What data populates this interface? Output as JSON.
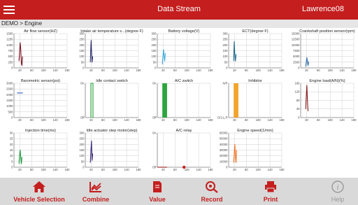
{
  "header": {
    "title": "Data Stream",
    "user": "Lawrence08"
  },
  "breadcrumb": "DEMO > Engine",
  "colors": {
    "accent": "#c41e1e",
    "series": [
      "#7a1020",
      "#2a2a6a",
      "#3aa8d8",
      "#1a6a8a",
      "#2e6aa8",
      "#2a5abf",
      "#22a035",
      "#22a035",
      "#f0a020",
      "#8a1a1a",
      "#1d9a3c",
      "#3a2a7a",
      "#a01818",
      "#f07020"
    ]
  },
  "nav": [
    {
      "label": "Vehicle Selection",
      "icon": "home-icon"
    },
    {
      "label": "Combine",
      "icon": "combine-chart-icon"
    },
    {
      "label": "Value",
      "icon": "document-value-icon"
    },
    {
      "label": "Record",
      "icon": "record-search-icon"
    },
    {
      "label": "Print",
      "icon": "printer-icon"
    },
    {
      "label": "Help",
      "icon": "info-help-icon"
    }
  ],
  "chart_data": [
    {
      "type": "line",
      "title": "Air flow sensor(HZ)",
      "xlim": [
        0,
        180
      ],
      "xticks": [
        "20",
        "60",
        "100",
        "140",
        "180"
      ],
      "ylim": [
        0,
        1500
      ],
      "yticks": [
        "0",
        "250",
        "500",
        "750",
        "1000",
        "1250",
        "1500"
      ],
      "series": [
        {
          "x": [
            17,
            19,
            21,
            23,
            25,
            27,
            29
          ],
          "y": [
            300,
            700,
            1100,
            800,
            200,
            100,
            500
          ]
        }
      ]
    },
    {
      "type": "line",
      "title": "Intake air temperature s...(degree F)",
      "xlim": [
        0,
        180
      ],
      "xticks": [
        "20",
        "60",
        "100",
        "140",
        "180"
      ],
      "ylim": [
        0,
        300
      ],
      "yticks": [
        "0",
        "50",
        "100",
        "150",
        "200",
        "250",
        "300"
      ],
      "series": [
        {
          "x": [
            17,
            19,
            20,
            21,
            23,
            25
          ],
          "y": [
            50,
            200,
            240,
            150,
            50,
            100
          ]
        }
      ]
    },
    {
      "type": "line",
      "title": "Battery voltage(V)",
      "xlim": [
        0,
        180
      ],
      "xticks": [
        "20",
        "60",
        "100",
        "140",
        "180"
      ],
      "ylim": [
        0,
        300
      ],
      "yticks": [
        "0",
        "50",
        "100",
        "150",
        "200",
        "250",
        "300"
      ],
      "series": [
        {
          "x": [
            17,
            19,
            21,
            23,
            25,
            27
          ],
          "y": [
            30,
            100,
            160,
            100,
            60,
            130
          ]
        }
      ]
    },
    {
      "type": "line",
      "title": "ECT(degree F)",
      "xlim": [
        0,
        180
      ],
      "xticks": [
        "20",
        "60",
        "100",
        "140",
        "180"
      ],
      "ylim": [
        0,
        300
      ],
      "yticks": [
        "0",
        "50",
        "100",
        "150",
        "200",
        "250",
        "300"
      ],
      "series": [
        {
          "x": [
            17,
            19,
            21,
            23,
            25
          ],
          "y": [
            60,
            230,
            110,
            60,
            120
          ]
        }
      ]
    },
    {
      "type": "line",
      "title": "Crankshaft position sensor(rpm)",
      "xlim": [
        0,
        180
      ],
      "xticks": [
        "20",
        "60",
        "100",
        "140",
        "180"
      ],
      "ylim": [
        0,
        15000
      ],
      "yticks": [
        "0",
        "2500",
        "5000",
        "7500",
        "10000",
        "12500",
        "15000"
      ],
      "series": [
        {
          "x": [
            17,
            19,
            21,
            23,
            25,
            27
          ],
          "y": [
            500,
            2500,
            4500,
            2500,
            1000,
            2800
          ]
        }
      ]
    },
    {
      "type": "line",
      "title": "Barometric sensor(psi)",
      "xlim": [
        0,
        180
      ],
      "xticks": [
        "20",
        "60",
        "100",
        "140",
        "180"
      ],
      "ylim": [
        0,
        3000
      ],
      "yticks": [
        "0",
        "500",
        "1000",
        "1500",
        "2000",
        "2500",
        "3000"
      ],
      "series": [
        {
          "x": [
            10,
            30
          ],
          "y": [
            2150,
            2150
          ]
        }
      ]
    },
    {
      "type": "line",
      "title": "Idle contact switch",
      "xlim": [
        0,
        180
      ],
      "xticks": [
        "20",
        "60",
        "100",
        "140",
        "180"
      ],
      "ylim": [
        0,
        1
      ],
      "yticks": [
        "Off",
        "On"
      ],
      "series": [
        {
          "x": [
            18,
            19,
            19,
            26,
            26,
            28
          ],
          "y": [
            0,
            0,
            1,
            1,
            0,
            0
          ]
        }
      ]
    },
    {
      "type": "area",
      "title": "A/C switch",
      "xlim": [
        0,
        180
      ],
      "xticks": [
        "20",
        "60",
        "100",
        "140",
        "180"
      ],
      "ylim": [
        0,
        1
      ],
      "yticks": [
        "Off",
        "On"
      ],
      "series": [
        {
          "x": [
            17,
            33
          ],
          "y": [
            1,
            1
          ]
        }
      ]
    },
    {
      "type": "area",
      "title": "Inhibitor",
      "xlim": [
        0,
        180
      ],
      "xticks": [
        "20",
        "60",
        "100",
        "140",
        "180"
      ],
      "ylim": [
        0,
        1
      ],
      "yticks": [
        "D/2,L,R",
        "N/P"
      ],
      "series": [
        {
          "x": [
            17,
            33
          ],
          "y": [
            1,
            1
          ]
        }
      ]
    },
    {
      "type": "line",
      "title": "Engine load(A/N)(%)",
      "xlim": [
        0,
        180
      ],
      "xticks": [
        "20",
        "60",
        "100",
        "140",
        "180"
      ],
      "ylim": [
        0,
        160
      ],
      "yticks": [
        "0",
        "40",
        "80",
        "120",
        "160"
      ],
      "series": [
        {
          "x": [
            17,
            19,
            21,
            23,
            25
          ],
          "y": [
            40,
            100,
            150,
            80,
            30
          ]
        }
      ]
    },
    {
      "type": "line",
      "title": "Injection time(ms)",
      "xlim": [
        0,
        180
      ],
      "xticks": [
        "20",
        "60",
        "100",
        "140",
        "180"
      ],
      "ylim": [
        0,
        30
      ],
      "yticks": [
        "0",
        "5",
        "10",
        "15",
        "20",
        "25",
        "30"
      ],
      "series": [
        {
          "x": [
            17,
            19,
            21,
            23,
            25,
            27
          ],
          "y": [
            3,
            11,
            15,
            8,
            3,
            9
          ]
        }
      ]
    },
    {
      "type": "line",
      "title": "Idle actuator step motor(step)",
      "xlim": [
        0,
        180
      ],
      "xticks": [
        "20",
        "60",
        "100",
        "140",
        "180"
      ],
      "ylim": [
        0,
        300
      ],
      "yticks": [
        "0",
        "50",
        "100",
        "150",
        "200",
        "250",
        "300"
      ],
      "series": [
        {
          "x": [
            17,
            19,
            21,
            23,
            25
          ],
          "y": [
            40,
            150,
            230,
            60,
            120
          ]
        }
      ]
    },
    {
      "type": "line",
      "title": "A/C relay",
      "xlim": [
        0,
        180
      ],
      "xticks": [
        "20",
        "60",
        "100",
        "140",
        "180"
      ],
      "ylim": [
        0,
        1
      ],
      "yticks": [
        "Off",
        "On"
      ],
      "series": [
        {
          "x": [
            0,
            33
          ],
          "y": [
            0,
            0
          ]
        }
      ]
    },
    {
      "type": "line",
      "title": "Engine speed(1/min)",
      "xlim": [
        0,
        180
      ],
      "xticks": [
        "20",
        "60",
        "100",
        "140",
        "180"
      ],
      "ylim": [
        0,
        60000
      ],
      "yticks": [
        "0",
        "10000",
        "20000",
        "30000",
        "40000",
        "50000",
        "60000"
      ],
      "series": [
        {
          "x": [
            17,
            19,
            21,
            23,
            25,
            27
          ],
          "y": [
            8000,
            25000,
            40000,
            18000,
            8000,
            30000
          ]
        }
      ]
    }
  ]
}
